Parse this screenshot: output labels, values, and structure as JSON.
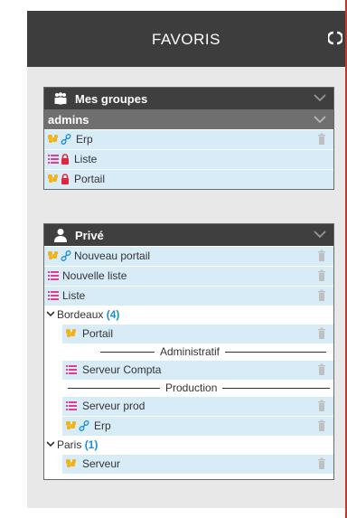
{
  "header": {
    "title": "FAVORIS"
  },
  "groups": {
    "title": "Mes groupes",
    "section": "admins",
    "items": [
      {
        "label": "Erp",
        "type": "portal-link"
      },
      {
        "label": "Liste",
        "type": "list-locked"
      },
      {
        "label": "Portail",
        "type": "portal-locked"
      }
    ]
  },
  "private": {
    "title": "Privé",
    "items": [
      {
        "label": "Nouveau portail",
        "type": "portal-link"
      },
      {
        "label": "Nouvelle liste",
        "type": "list"
      },
      {
        "label": "Liste",
        "type": "list"
      }
    ],
    "folders": [
      {
        "name": "Bordeaux",
        "count": "(4)",
        "items": [
          {
            "label": "Portail",
            "type": "portal"
          }
        ],
        "sections": [
          {
            "name": "Administratif",
            "items": [
              {
                "label": "Serveur Compta",
                "type": "list"
              }
            ]
          },
          {
            "name": "Production",
            "items": [
              {
                "label": "Serveur prod",
                "type": "list"
              },
              {
                "label": "Erp",
                "type": "portal-link"
              }
            ]
          }
        ]
      },
      {
        "name": "Paris",
        "count": "(1)",
        "items": [
          {
            "label": "Serveur",
            "type": "portal"
          }
        ]
      }
    ]
  },
  "colors": {
    "header": "#3d3d3d",
    "row": "#d8ecf8",
    "accent": "#1a8fd6",
    "lock": "#e0263a",
    "portal": "#f2b31a",
    "list": "#e23b8f"
  }
}
